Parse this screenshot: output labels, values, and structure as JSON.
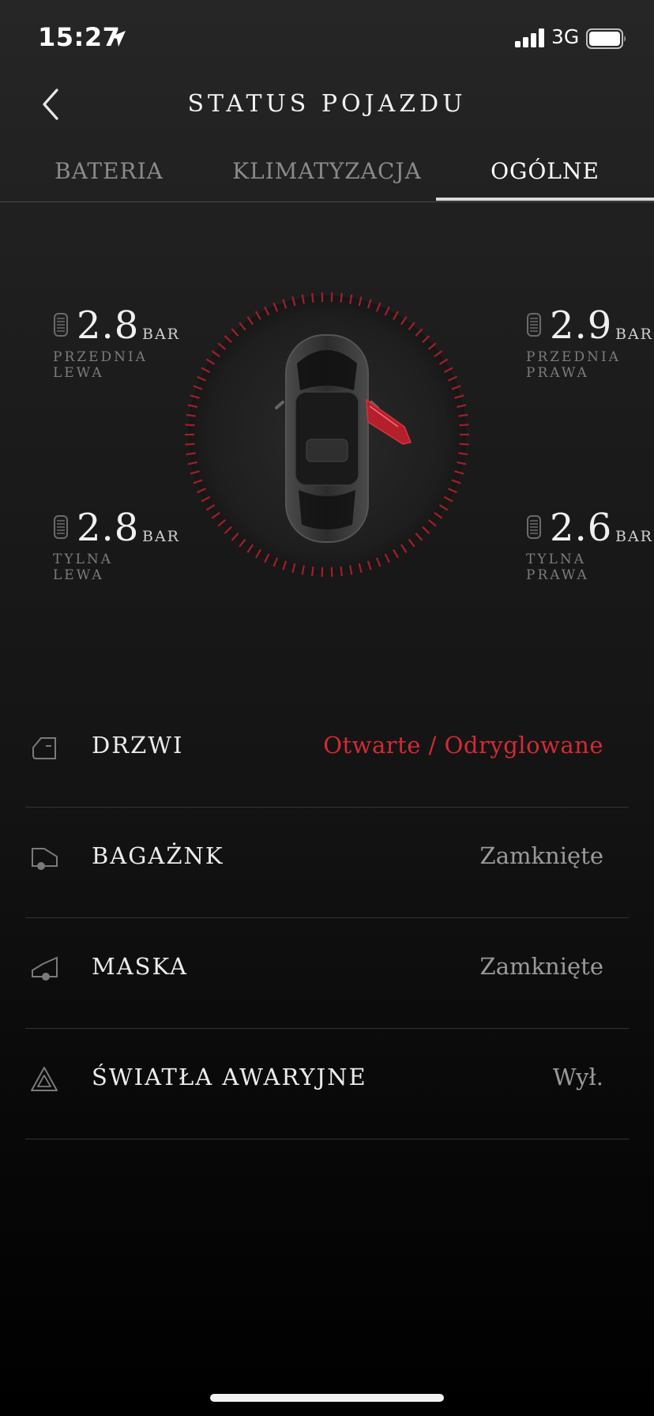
{
  "status_bar": {
    "time": "15:27",
    "network": "3G"
  },
  "header": {
    "title": "STATUS POJAZDU"
  },
  "tabs": [
    {
      "label": "BATERIA",
      "active": false
    },
    {
      "label": "KLIMATYZACJA",
      "active": false
    },
    {
      "label": "OGÓLNE",
      "active": true
    }
  ],
  "tyres": {
    "front_left": {
      "value": "2.8",
      "unit": "BAR",
      "label_line1": "PRZEDNIA",
      "label_line2": "LEWA"
    },
    "front_right": {
      "value": "2.9",
      "unit": "BAR",
      "label_line1": "PRZEDNIA",
      "label_line2": "PRAWA"
    },
    "rear_left": {
      "value": "2.8",
      "unit": "BAR",
      "label_line1": "TYLNA",
      "label_line2": "LEWA"
    },
    "rear_right": {
      "value": "2.6",
      "unit": "BAR",
      "label_line1": "TYLNA",
      "label_line2": "PRAWA"
    }
  },
  "status_rows": [
    {
      "label": "DRZWI",
      "value": "Otwarte / Odryglowane",
      "icon": "door-icon"
    },
    {
      "label": "BAGAŻNK",
      "value": "Zamknięte",
      "icon": "trunk-icon"
    },
    {
      "label": "MASKA",
      "value": "Zamknięte",
      "icon": "bonnet-icon"
    },
    {
      "label": "ŚWIATŁA AWARYJNE",
      "value": "Wył.",
      "icon": "hazard-icon"
    }
  ],
  "colors": {
    "alert": "#d42a35",
    "accent_ring": "#b3202c",
    "background": "#1b1b1b"
  }
}
